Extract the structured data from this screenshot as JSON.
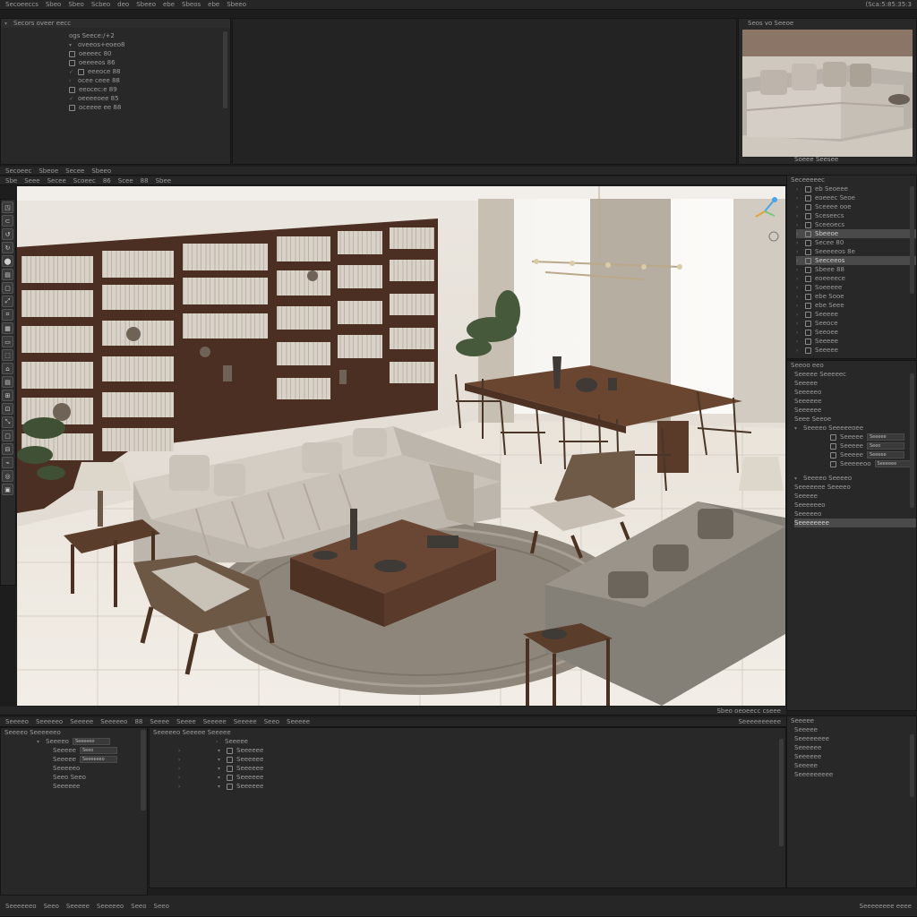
{
  "menu": {
    "items": [
      "Secoeeccs",
      "Sbeo",
      "Sbeo",
      "Scbeo",
      "deo",
      "Sbeeo",
      "ebe",
      "Sbeos",
      "ebe",
      "Sbeeo"
    ],
    "right": "(Sca:5:85:35:3"
  },
  "top_outliner": {
    "header": "Secors oveer eecc",
    "rows": [
      "ogs Seece:/+2",
      "oveeos+eoeo8",
      "oeeeec 80",
      "oeeeeos 86",
      "eeeoce 88",
      "ocee ceee 88",
      "eeocec:e 89",
      "oeeeeoee 85",
      "oceeee ee 88"
    ]
  },
  "preview": {
    "header": "Seos vo Seeoe",
    "caption": "Soeee Seesee"
  },
  "secondary_bar": [
    "Secoeec",
    "Sbeoe",
    "Secee",
    "Sbeeo"
  ],
  "viewport": {
    "toolbar": [
      "Sbe",
      "Seee",
      "Secee",
      "Scoeec",
      "86",
      "Scee",
      "88",
      "Sbee"
    ],
    "tools": [
      "◳",
      "⊂",
      "↺",
      "↻",
      "⬤",
      "▤",
      "▢",
      "⤢",
      "⌗",
      "▦",
      "▭",
      "⬚",
      "⌂",
      "▤",
      "⊞",
      "⊡",
      "⤡",
      "▢",
      "⊟",
      "⌁",
      "◎",
      "▣"
    ],
    "status": "Sbeo oeoeecc cseee"
  },
  "right_outliner": {
    "header": "Seceeeeec",
    "rows": [
      "eb Seoeee",
      "eoeeec Seoe",
      "Sceeee ooe",
      "Sceseecs",
      "Sceeoecs",
      "Sbeeoe",
      "Secee 80",
      "Seeeeeos 8e",
      "Seeceeos",
      "Sbeee 88",
      "eoeeeece",
      "Soeeeee",
      "ebe Sooe",
      "ebe Seee",
      "Seeeee",
      "Seeoce",
      "Seeoee",
      "Seeeee",
      "Seeeee"
    ],
    "selected": [
      5,
      8
    ]
  },
  "properties": {
    "header": "Seeoo eeo",
    "rows": [
      "Seeeee Seeeeec",
      "Seeeee",
      "Seeeeeo",
      "Seeeeee",
      "Seeeeee",
      "Seee Seeoe"
    ],
    "section": "Seeeeo Seeeeeoee",
    "fields": [
      {
        "label": "Seeeee",
        "value": "Seeeee"
      },
      {
        "label": "Seeeee",
        "value": "Seeo"
      },
      {
        "label": "Seeeee",
        "value": "Seeeee"
      },
      {
        "label": "Seeeeeoo",
        "value": "Seeeeee"
      }
    ],
    "section2": "Seeeeo Seeeeo",
    "rows2": [
      "Seeeeeee Seeeeo",
      "Seeeee",
      "Seeeeeeo",
      "Seeeeeo",
      "Seeeeeeee"
    ]
  },
  "timeline": {
    "items": [
      "Seeeeo",
      "Seeeeeo",
      "Seeeee",
      "Seeeeeo",
      "88",
      "Seeee",
      "Seeee",
      "Seeeee",
      "Seeeee",
      "Seeo",
      "Seeeee"
    ],
    "status": "Seeeeeeeeee"
  },
  "bottom_left": {
    "header": "Seeeeo Seeeeeeo",
    "rows": [
      {
        "label": "Seeeeo",
        "value": "Seeeeeo"
      },
      {
        "label": "Seeeee",
        "value": "Seeo"
      },
      {
        "label": "Seeeee",
        "value": "Seeeeeeo"
      },
      {
        "label": "Seeeeeo",
        "value": ""
      },
      {
        "label": "Seeo Seeo",
        "value": ""
      },
      {
        "label": "Seeeeee",
        "value": ""
      }
    ]
  },
  "bottom_mid": {
    "header": "Seeeeeo Seeeee Seeeee",
    "rows": [
      "Seeeee",
      "Seeeeee",
      "Seeeeee",
      "Seeeeee",
      "Seeeeee",
      "Seeeeee"
    ]
  },
  "bottom_right": {
    "header": "Seeeee",
    "rows": [
      "Seeeee",
      "Seeeeeeee",
      "Seeeeee",
      "Seeeeee",
      "Seeeee",
      "Seeeeeeeee"
    ]
  },
  "footer": {
    "left": [
      "Seeeeeeo",
      "Seeo",
      "Seeeee",
      "Seeeeeo",
      "Seeo",
      "Seeo"
    ],
    "right": "Seeeeeeee eeee"
  }
}
